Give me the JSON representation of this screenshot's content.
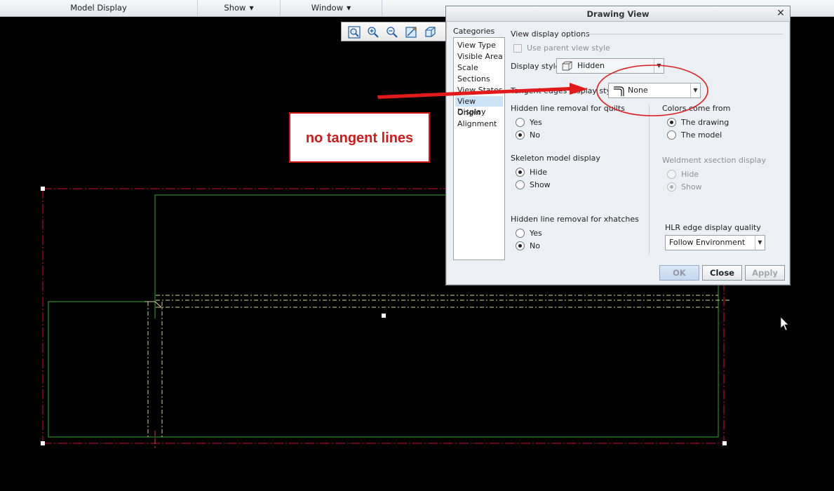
{
  "menubar": {
    "items": [
      {
        "label": "Model Display",
        "has_caret": false
      },
      {
        "label": "Show",
        "has_caret": true
      },
      {
        "label": "Window",
        "has_caret": true
      }
    ]
  },
  "toolbar": {
    "icons": [
      "zoom-fit-icon",
      "zoom-in-icon",
      "zoom-out-icon",
      "repaint-icon",
      "display-style-icon"
    ]
  },
  "callout": {
    "text": "no tangent lines",
    "color": "#d31a1a"
  },
  "dialog": {
    "title": "Drawing View",
    "categories_label": "Categories",
    "categories": [
      {
        "label": "View Type",
        "selected": false
      },
      {
        "label": "Visible Area",
        "selected": false
      },
      {
        "label": "Scale",
        "selected": false
      },
      {
        "label": "Sections",
        "selected": false
      },
      {
        "label": "View States",
        "selected": false
      },
      {
        "label": "View Display",
        "selected": true
      },
      {
        "label": "Origin",
        "selected": false
      },
      {
        "label": "Alignment",
        "selected": false
      }
    ],
    "section_title": "View display options",
    "use_parent_label": "Use parent view style",
    "display_style": {
      "label": "Display style",
      "value": "Hidden",
      "icon": "hidden-style-icon"
    },
    "tangent_edges": {
      "label": "Tangent edges display style",
      "value": "None",
      "icon": "tangent-none-icon"
    },
    "hlr_quilts": {
      "label": "Hidden line removal for quilts",
      "options": [
        "Yes",
        "No"
      ],
      "selected": "No"
    },
    "colors_from": {
      "label": "Colors come from",
      "options": [
        "The drawing",
        "The model"
      ],
      "selected": "The drawing"
    },
    "skeleton": {
      "label": "Skeleton model display",
      "options": [
        "Hide",
        "Show"
      ],
      "selected": "Hide"
    },
    "weldment": {
      "label": "Weldment xsection display",
      "options": [
        "Hide",
        "Show"
      ],
      "selected": "Show"
    },
    "hlr_xhatch": {
      "label": "Hidden line removal for xhatches",
      "options": [
        "Yes",
        "No"
      ],
      "selected": "No"
    },
    "hlr_quality": {
      "label": "HLR edge display quality",
      "value": "Follow Environment"
    },
    "buttons": {
      "ok": "OK",
      "close": "Close",
      "apply": "Apply"
    }
  },
  "colors": {
    "background": "#000000",
    "border_line": "#d0102a",
    "model_line": "#3aa83a",
    "hidden_line": "#d8d89a",
    "annotation": "#e11b1b"
  }
}
